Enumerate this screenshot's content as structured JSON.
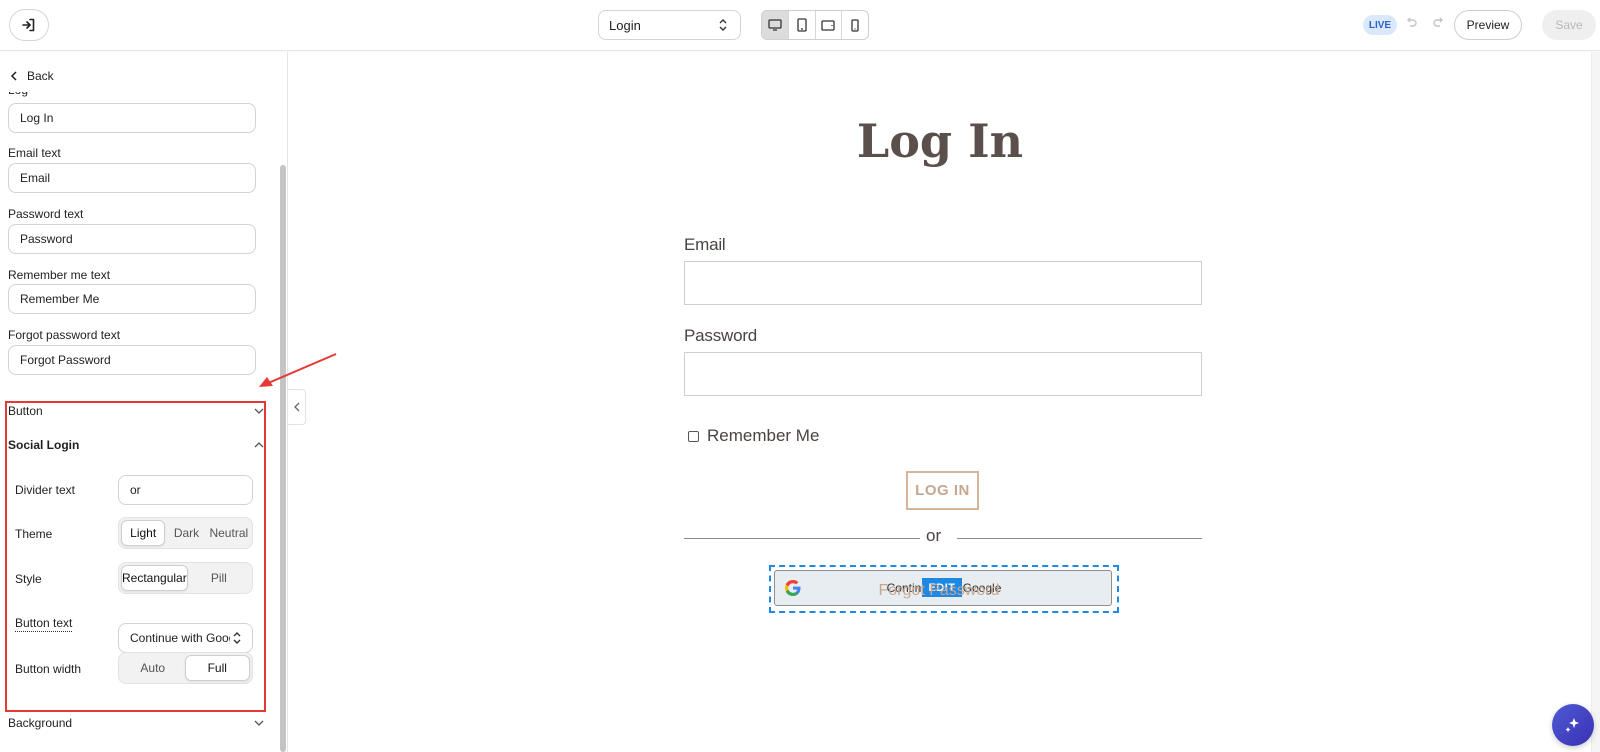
{
  "topbar": {
    "page_select": "Login",
    "live_badge": "LIVE",
    "preview_label": "Preview",
    "save_label": "Save",
    "devices": [
      "desktop-icon",
      "tablet-icon",
      "tablet-landscape-icon",
      "mobile-icon"
    ]
  },
  "sidebar": {
    "back_label": "Back",
    "fields": [
      {
        "label": "",
        "value": "Log In"
      },
      {
        "label": "Email text",
        "value": "Email"
      },
      {
        "label": "Password text",
        "value": "Password"
      },
      {
        "label": "Remember me text",
        "value": "Remember Me"
      },
      {
        "label": "Forgot password text",
        "value": "Forgot Password"
      }
    ],
    "sections": {
      "button": "Button",
      "social_login": "Social Login",
      "background": "Background"
    },
    "social_login": {
      "divider_label": "Divider text",
      "divider_value": "or",
      "theme_label": "Theme",
      "theme_options": [
        "Light",
        "Dark",
        "Neutral"
      ],
      "theme_selected": "Light",
      "style_label": "Style",
      "style_options": [
        "Rectangular",
        "Pill"
      ],
      "style_selected": "Rectangular",
      "button_text_label": "Button text",
      "button_text_value": "Continue with Google",
      "button_width_label": "Button width",
      "width_options": [
        "Auto",
        "Full"
      ],
      "width_selected": "Full"
    }
  },
  "canvas": {
    "title": "Log In",
    "email_label": "Email",
    "password_label": "Password",
    "remember_label": "Remember Me",
    "login_button": "LOG IN",
    "divider": "or",
    "google_button": "Continue with Google",
    "edit_badge": "EDIT",
    "forgot": "Forgot Password"
  },
  "colors": {
    "accent_blue": "#1e88e5",
    "highlight_red": "#e53935",
    "brand_tan": "#c6a790",
    "title_brown": "#5b4f4b"
  }
}
